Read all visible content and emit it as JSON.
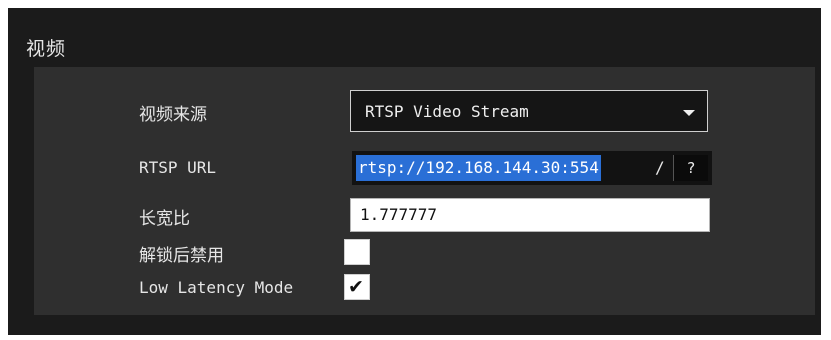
{
  "section": {
    "title": "视频"
  },
  "fields": {
    "video_source": {
      "label": "视频来源",
      "value": "RTSP Video Stream"
    },
    "rtsp_url": {
      "label": "RTSP URL",
      "value_selected": "rtsp://192.168.144.30:554",
      "value_rest": "/",
      "help_label": "?"
    },
    "aspect_ratio": {
      "label": "长宽比",
      "value": "1.777777"
    },
    "disable_on_unlock": {
      "label": "解锁后禁用",
      "checked": false
    },
    "low_latency": {
      "label": "Low Latency Mode",
      "checked": true,
      "mark": "✔"
    }
  },
  "colors": {
    "panel": "#2f2f2f",
    "frame": "#1b1b1b",
    "selection": "#2a6fd6"
  },
  "icons": {
    "dropdown": "caret-down-icon",
    "checkmark": "checkmark-icon"
  }
}
